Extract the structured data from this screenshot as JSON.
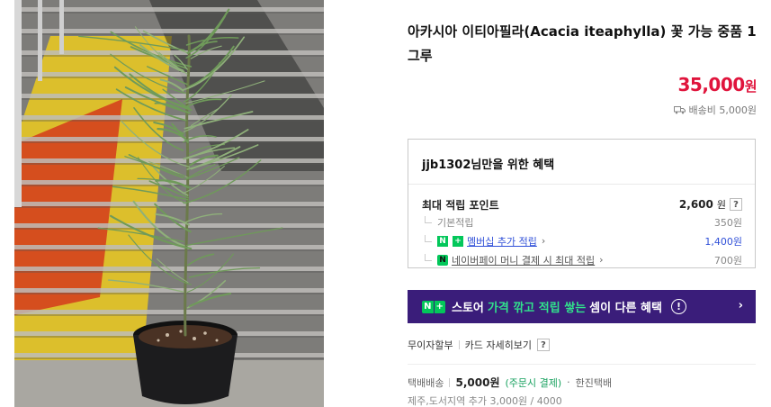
{
  "product": {
    "title": "아카시아 이티아필라(Acacia iteaphylla) 꽃 가능 중품 1그루",
    "price_value": "35,000",
    "price_unit": "원",
    "shipping_fee": "배송비 5,000원"
  },
  "benefit": {
    "heading": "jjb1302님만을 위한 혜택",
    "max_points_label": "최대 적립 포인트",
    "max_points_value": "2,600",
    "max_points_unit": "원",
    "help": "?",
    "rows": [
      {
        "label": "기본적립",
        "value": "350원"
      },
      {
        "label": "멤버십 추가 적립",
        "value": "1,400원"
      },
      {
        "label": "네이버페이 머니 결제 시 최대 적립",
        "value": "700원"
      }
    ]
  },
  "banner": {
    "badge_n": "N",
    "badge_plus": "+",
    "prefix": "스토어",
    "highlight": "가격 깎고 적립 쌓는",
    "suffix": "셈이 다른 혜택",
    "info": "!",
    "arrow": "›"
  },
  "payment": {
    "installment": "무이자할부",
    "card_detail": "카드 자세히보기",
    "help": "?"
  },
  "delivery": {
    "method": "택배배송",
    "fee": "5,000원",
    "fee_note": "(주문시 결제)",
    "courier": "한진택배",
    "extra": "제주,도서지역 추가 3,000원 / 4000"
  },
  "colors": {
    "price": "#e0143c",
    "banner_bg": "#3a1d7a",
    "naver_green": "#03c75a",
    "link_blue": "#3050d8"
  },
  "icons": {
    "shipping": "truck-icon",
    "chevron": "chevron-right-icon",
    "info": "info-circle-icon"
  }
}
